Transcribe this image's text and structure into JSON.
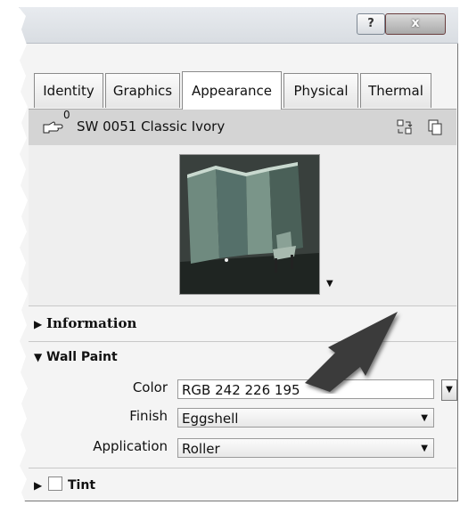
{
  "titlebar": {
    "help_label": "?",
    "close_label": "x"
  },
  "tabs": [
    {
      "label": "Identity"
    },
    {
      "label": "Graphics"
    },
    {
      "label": "Appearance",
      "active": true
    },
    {
      "label": "Physical"
    },
    {
      "label": "Thermal"
    }
  ],
  "material": {
    "usage_count": "0",
    "name": "SW 0051 Classic Ivory"
  },
  "sections": {
    "information": {
      "label": "Information"
    },
    "wall_paint": {
      "label": "Wall Paint"
    },
    "tint": {
      "label": "Tint",
      "checked": false
    }
  },
  "properties": {
    "color": {
      "label": "Color",
      "value": "RGB 242 226 195"
    },
    "finish": {
      "label": "Finish",
      "value": "Eggshell"
    },
    "application": {
      "label": "Application",
      "value": "Roller"
    }
  },
  "colors": {
    "arrow": "#3a3a3a",
    "paint_swatch": "#f2e2c3"
  }
}
